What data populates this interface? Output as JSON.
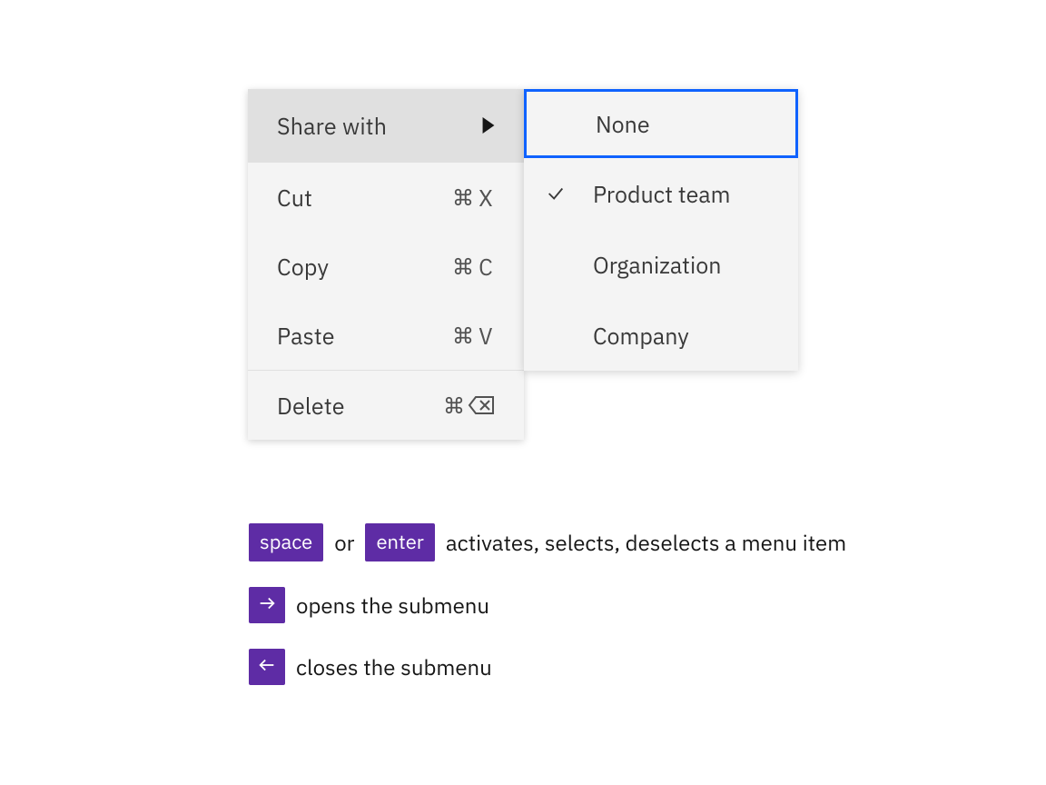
{
  "colors": {
    "accent": "#0f62fe",
    "key_bg": "#5e2ca5",
    "surface": "#f4f4f4",
    "surface_hover": "#e0e0e0"
  },
  "menu": {
    "share_with": {
      "label": "Share with"
    },
    "cut": {
      "label": "Cut",
      "shortcut_key": "X"
    },
    "copy": {
      "label": "Copy",
      "shortcut_key": "C"
    },
    "paste": {
      "label": "Paste",
      "shortcut_key": "V"
    },
    "delete": {
      "label": "Delete"
    }
  },
  "submenu": {
    "items": [
      {
        "label": "None",
        "checked": false,
        "focused": true
      },
      {
        "label": "Product team",
        "checked": true,
        "focused": false
      },
      {
        "label": "Organization",
        "checked": false,
        "focused": false
      },
      {
        "label": "Company",
        "checked": false,
        "focused": false
      }
    ]
  },
  "legend": {
    "r1": {
      "key_space": "space",
      "or": "or",
      "key_enter": "enter",
      "text": "activates, selects, deselects a menu item"
    },
    "r2": {
      "text": "opens the submenu"
    },
    "r3": {
      "text": "closes the submenu"
    }
  }
}
